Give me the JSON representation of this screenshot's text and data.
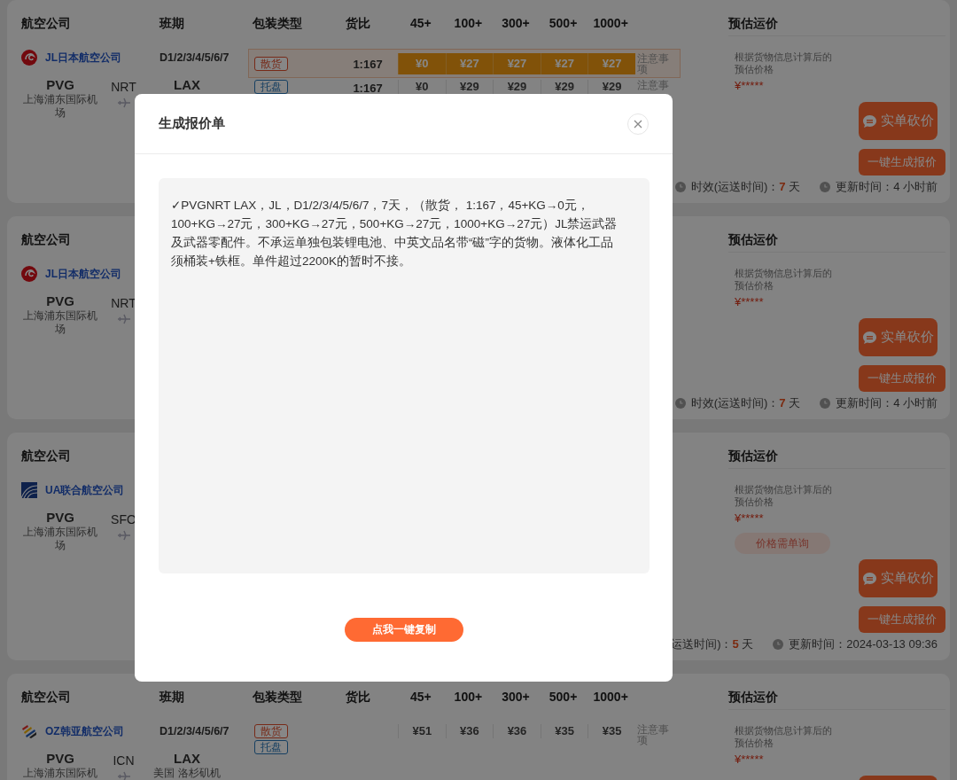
{
  "cards": [
    {
      "columns": {
        "airline": "航空公司",
        "schedule": "班期",
        "packing": "包装类型",
        "ratio": "货比",
        "weights": [
          "45+",
          "100+",
          "300+",
          "500+",
          "1000+"
        ],
        "estimate": "预估运价"
      },
      "airline": {
        "name": "JL日本航空公司",
        "kind": "crane"
      },
      "schedule": "D1/2/3/4/5/6/7",
      "route": {
        "origin": {
          "code": "PVG",
          "airport": "上海浦东国际机场"
        },
        "transit": "NRT",
        "destination": {
          "code": "LAX"
        }
      },
      "rows": [
        {
          "selected": true,
          "packing": [
            {
              "label": "散货",
              "kind": "bulk"
            }
          ],
          "ratio": "1:167",
          "prices": [
            "¥0",
            "¥27",
            "¥27",
            "¥27",
            "¥27"
          ],
          "notes": "注意事项"
        },
        {
          "selected": false,
          "packing": [
            {
              "label": "托盘",
              "kind": "pallet"
            }
          ],
          "ratio": "1:167",
          "prices": [
            "¥0",
            "¥29",
            "¥29",
            "¥29",
            "¥29"
          ],
          "notes": "注意事"
        }
      ],
      "estimate": {
        "description": "根据货物信息计算后的预估价格",
        "price": "¥*****",
        "buttons": [
          {
            "label": "实单砍价",
            "kind": "chat"
          },
          {
            "label": "一键生成报价",
            "kind": "plain"
          }
        ]
      },
      "footer": {
        "items": [
          {
            "kind": "clock",
            "text": "时效(运送时间)：**7** 天"
          },
          {
            "kind": "clock",
            "text": "更新时间：4 小时前"
          }
        ]
      }
    },
    {
      "columns": {
        "airline": "航空公司",
        "estimate": "预估运价"
      },
      "airline": {
        "name": "JL日本航空公司",
        "kind": "crane"
      },
      "route": {
        "origin": {
          "code": "PVG",
          "airport": "上海浦东国际机场"
        },
        "transit": "NRT"
      },
      "estimate": {
        "description": "根据货物信息计算后的预估价格",
        "price": "¥*****",
        "buttons": [
          {
            "label": "实单砍价",
            "kind": "chat"
          },
          {
            "label": "一键生成报价",
            "kind": "plain"
          }
        ]
      },
      "footer": {
        "items": [
          {
            "kind": "clock",
            "text": "时效(运送时间)：**7** 天"
          },
          {
            "kind": "clock",
            "text": "更新时间：4 小时前"
          }
        ]
      }
    },
    {
      "columns": {
        "airline": "航空公司",
        "estimate": "预估运价"
      },
      "airline": {
        "name": "UA联合航空公司",
        "kind": "globe"
      },
      "route": {
        "origin": {
          "code": "PVG",
          "airport": "上海浦东国际机场"
        },
        "transit": "SFO"
      },
      "estimate": {
        "description": "根据货物信息计算后的预估价格",
        "price": "¥*****",
        "inquiry": "价格需单询",
        "buttons": [
          {
            "label": "实单砍价",
            "kind": "chat"
          },
          {
            "label": "一键生成报价",
            "kind": "plain"
          }
        ]
      },
      "footer": {
        "items": [
          {
            "kind": "text",
            "text": "运送时间)：**5** 天"
          },
          {
            "kind": "clock",
            "text": "更新时间：2024-03-13 09:36"
          }
        ]
      }
    },
    {
      "columns": {
        "airline": "航空公司",
        "schedule": "班期",
        "packing": "包装类型",
        "ratio": "货比",
        "weights": [
          "45+",
          "100+",
          "300+",
          "500+",
          "1000+"
        ],
        "estimate": "预估运价"
      },
      "airline": {
        "name": "OZ韩亚航空公司",
        "kind": "stripes"
      },
      "schedule": "D1/2/3/4/5/6/7",
      "route": {
        "origin": {
          "code": "PVG",
          "airport": "上海浦东国际机"
        },
        "transit": "ICN",
        "destination": {
          "code": "LAX",
          "airport": "美国 洛杉矶机"
        }
      },
      "rows": [
        {
          "selected": false,
          "packing": [
            {
              "label": "散货",
              "kind": "bulk"
            },
            {
              "label": "托盘",
              "kind": "pallet"
            }
          ],
          "prices": [
            "¥51",
            "¥36",
            "¥36",
            "¥35",
            "¥35"
          ],
          "notes": "注意事项"
        }
      ],
      "estimate": {
        "description": "根据货物信息计算后的预估价格",
        "price": "¥*****",
        "buttons": [
          {
            "kind": "partial"
          }
        ]
      }
    }
  ],
  "dialog": {
    "title": "生成报价单",
    "text": "✓PVGNRT LAX，JL，D1/2/3/4/5/6/7，7天，（散货， 1:167，45+KG→0元，100+KG→27元，300+KG→27元，500+KG→27元，1000+KG→27元）JL禁运武器及武器零配件。不承运单独包装锂电池、中英文品名带“磁”字的货物。液体化工品须桶装+铁框。单件超过2200K的暂时不接。",
    "copy_button": "点我一键复制"
  }
}
